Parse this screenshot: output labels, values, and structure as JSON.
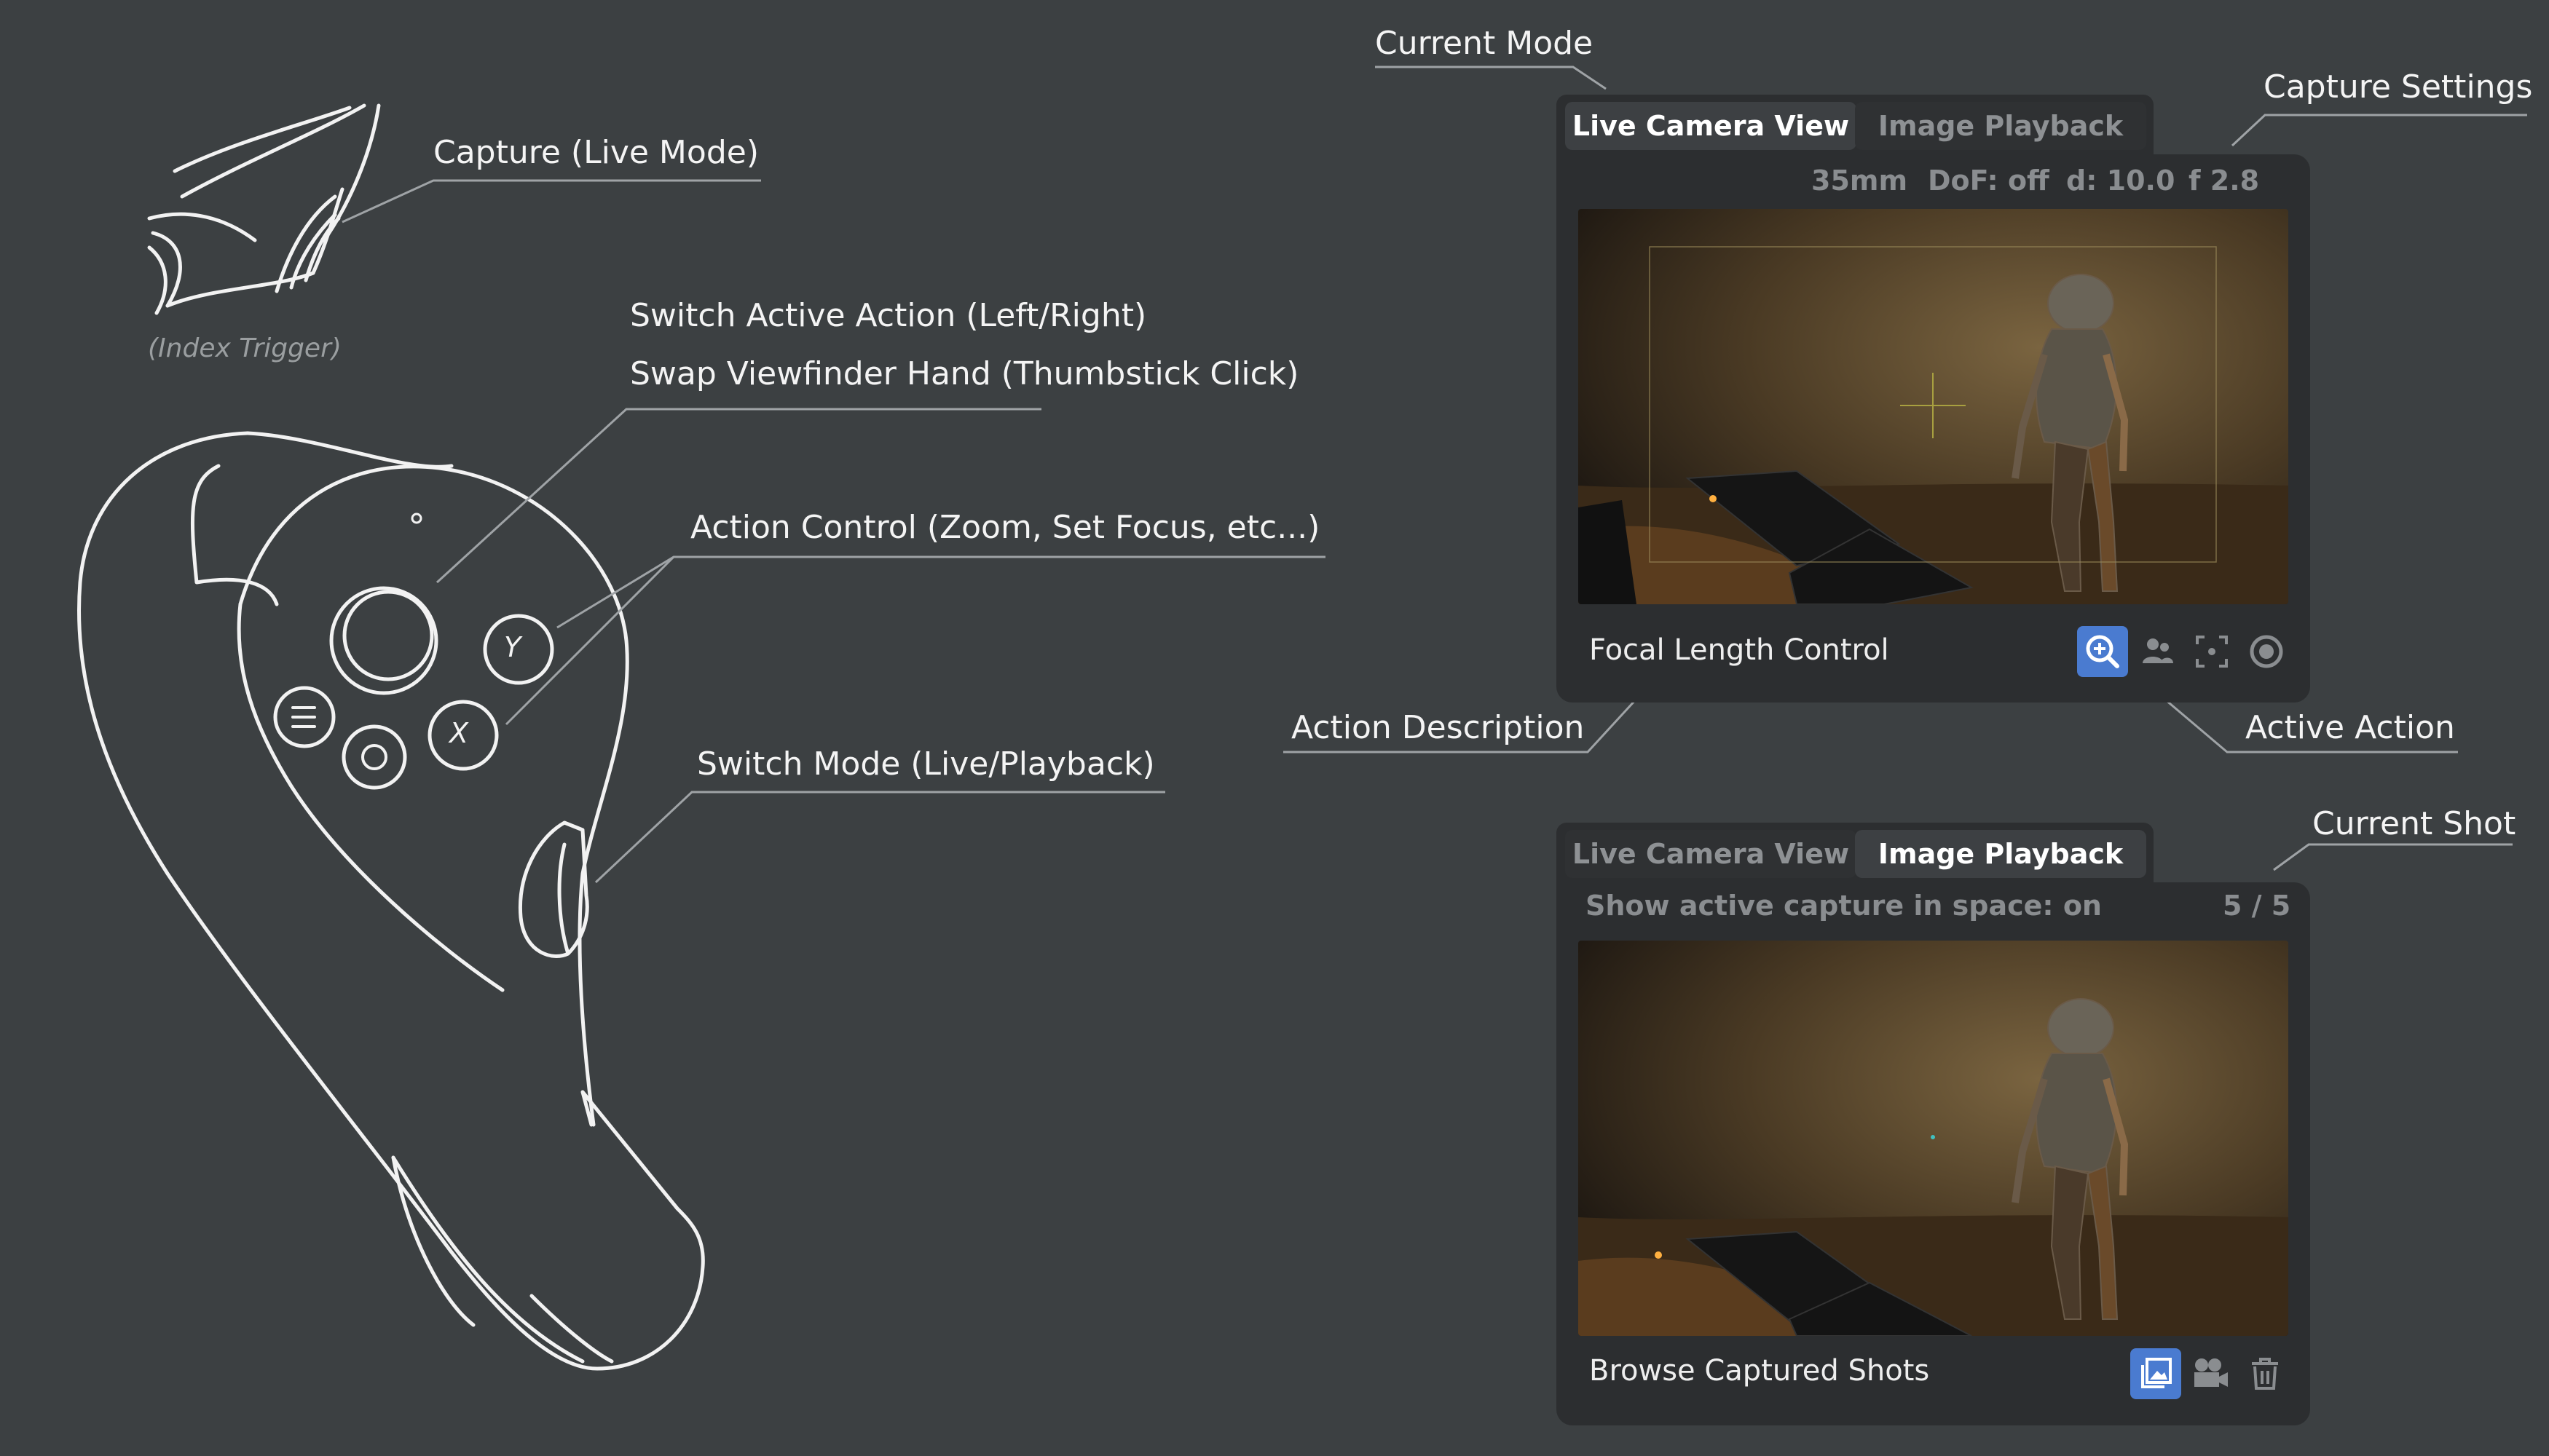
{
  "controller_labels": {
    "capture": "Capture (Live Mode)",
    "index_trigger": "(Index Trigger)",
    "switch_action": "Switch Active Action (Left/Right)",
    "swap_hand": "Swap Viewfinder Hand (Thumbstick Click)",
    "action_control": "Action Control (Zoom, Set Focus, etc...)",
    "switch_mode": "Switch Mode (Live/Playback)",
    "button_y": "Y",
    "button_x": "X"
  },
  "panel_labels": {
    "current_mode": "Current Mode",
    "capture_settings": "Capture Settings",
    "action_description": "Action Description",
    "active_action": "Active Action",
    "current_shot": "Current Shot"
  },
  "live_panel": {
    "tabs": [
      "Live Camera View",
      "Image Playback"
    ],
    "active_tab": 0,
    "settings": {
      "focal": "35mm",
      "dof": "DoF: off",
      "distance": "d: 10.0",
      "fstop": "f 2.8"
    },
    "description": "Focal Length Control",
    "actions": [
      {
        "icon": "zoom-in-icon",
        "active": true
      },
      {
        "icon": "people-focus-icon",
        "active": false
      },
      {
        "icon": "focus-frame-icon",
        "active": false
      },
      {
        "icon": "aperture-icon",
        "active": false
      }
    ]
  },
  "playback_panel": {
    "tabs": [
      "Live Camera View",
      "Image Playback"
    ],
    "active_tab": 1,
    "show_capture": "Show active capture in space: on",
    "shot_counter": "5 / 5",
    "description": "Browse Captured Shots",
    "actions": [
      {
        "icon": "gallery-icon",
        "active": true
      },
      {
        "icon": "camera-icon",
        "active": false
      },
      {
        "icon": "trash-icon",
        "active": false
      }
    ]
  },
  "colors": {
    "background": "#3c4042",
    "panel": "#2c2e30",
    "accent": "#4a7bd0",
    "line": "#9fa3a6"
  }
}
